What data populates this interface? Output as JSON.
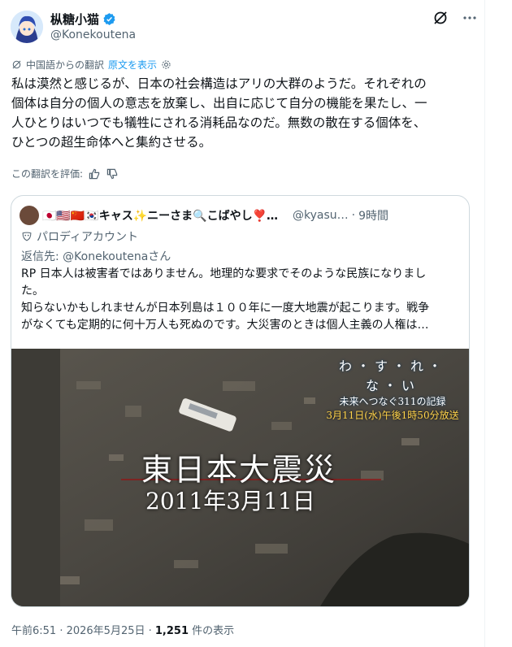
{
  "author": {
    "name": "枞糖小猫",
    "handle": "@Konekoutena"
  },
  "translation": {
    "label": "中国語からの翻訳",
    "show_original": "原文を表示"
  },
  "tweet_lines": [
    "私は漠然と感じるが、日本の社会構造はアリの大群のようだ。それぞれの",
    "個体は自分の個人の意志を放棄し、出自に応じて自分の機能を果たし、一",
    "人ひとりはいつでも犠牲にされる消耗品なのだ。無数の散在する個体を、",
    "ひとつの超生命体へと集約させる。"
  ],
  "rate_label": "この翻訳を評価:",
  "quoted": {
    "name": "🇯🇵🇺🇸🇨🇳🇰🇷キャス✨ニーさま🔍こばやし❣️探偵プリ…",
    "handle": "@kyasu…",
    "time": "9時間",
    "parody_label": "パロディアカウント",
    "reply_to": "返信先: @Konekoutenaさん",
    "text_lines": [
      "RP 日本人は被害者ではありません。地理的な要求でそのような民族になりまし",
      "た。",
      "知らないかもしれませんが日本列島は１００年に一度大地震が起こります。戦争",
      "がなくても定期的に何十万人も死ぬのです。大災害のときは個人主義の人権は…"
    ],
    "image": {
      "caption_main": "東日本大震災",
      "caption_date": "2011年3月11日",
      "logo_main": "わ・す・れ・な・い",
      "logo_sub": "未来へつなぐ311の記録",
      "logo_date": "3月11日(水)午後1時50分放送"
    }
  },
  "footer": {
    "time_date": "午前6:51 · 2026年5月25日 · ",
    "views": "1,251",
    "views_label": " 件の表示"
  },
  "colors": {
    "link": "#1d9bf0",
    "muted": "#536471",
    "border": "#cfd9de"
  }
}
